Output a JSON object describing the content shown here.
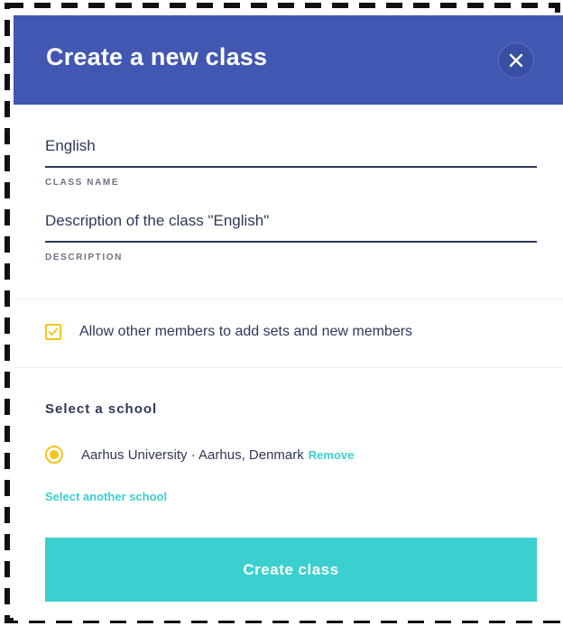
{
  "dialog": {
    "title": "Create a new class",
    "close_icon": "close-icon"
  },
  "form": {
    "class_name": {
      "value": "English",
      "label": "CLASS NAME"
    },
    "description": {
      "value": "Description of the class \"English\"",
      "label": "DESCRIPTION"
    },
    "allow_members": {
      "checked": true,
      "label": "Allow other members to add sets and new members"
    }
  },
  "school": {
    "section_title": "Select a school",
    "selected_name": "Aarhus University · Aarhus, Denmark",
    "remove_label": "Remove",
    "select_another_label": "Select another school"
  },
  "actions": {
    "create_label": "Create class"
  },
  "colors": {
    "header_bg": "#4257b2",
    "accent_teal": "#3ccfcf",
    "accent_yellow": "#f5c518",
    "text_dark": "#2e3856"
  }
}
